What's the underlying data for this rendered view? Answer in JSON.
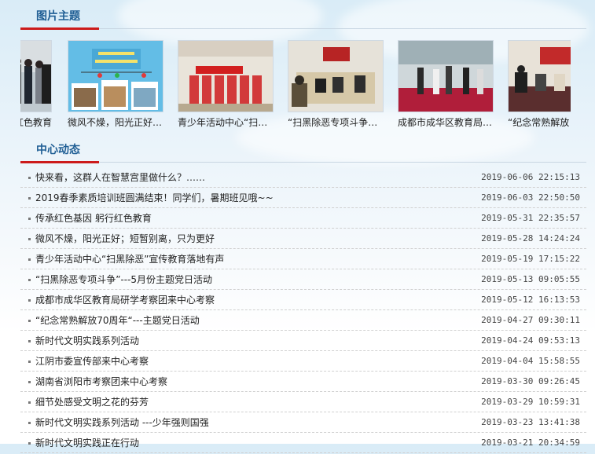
{
  "gallery": {
    "title": "图片主题",
    "items": [
      {
        "caption": "躬行红色教育"
      },
      {
        "caption": "微风不燥，阳光正好…"
      },
      {
        "caption": "青少年活动中心“扫…"
      },
      {
        "caption": "“扫黑除恶专项斗争…"
      },
      {
        "caption": "成都市成华区教育局…"
      },
      {
        "caption": "“纪念常熟解放"
      }
    ]
  },
  "news": {
    "title": "中心动态",
    "items": [
      {
        "title": "快来看，这群人在智慧宫里做什么？……",
        "date": "2019-06-06 22:15:13"
      },
      {
        "title": "2019春季素质培训班圆满结束！同学们，暑期班见哦~~",
        "date": "2019-06-03 22:50:50"
      },
      {
        "title": "传承红色基因 躬行红色教育",
        "date": "2019-05-31 22:35:57"
      },
      {
        "title": "微风不燥，阳光正好；短暂别离，只为更好",
        "date": "2019-05-28 14:24:24"
      },
      {
        "title": "青少年活动中心“扫黑除恶”宣传教育落地有声",
        "date": "2019-05-19 17:15:22"
      },
      {
        "title": "“扫黑除恶专项斗争”---5月份主题党日活动",
        "date": "2019-05-13 09:05:55"
      },
      {
        "title": "成都市成华区教育局研学考察团来中心考察",
        "date": "2019-05-12 16:13:53"
      },
      {
        "title": "“纪念常熟解放70周年“---主题党日活动",
        "date": "2019-04-27 09:30:11"
      },
      {
        "title": "新时代文明实践系列活动",
        "date": "2019-04-24 09:53:13"
      },
      {
        "title": "江阴市委宣传部来中心考察",
        "date": "2019-04-04 15:58:55"
      },
      {
        "title": "湖南省浏阳市考察团来中心考察",
        "date": "2019-03-30 09:26:45"
      },
      {
        "title": "细节处感受文明之花的芬芳",
        "date": "2019-03-29 10:59:31"
      },
      {
        "title": "新时代文明实践系列活动 ---少年强则国强",
        "date": "2019-03-23 13:41:38"
      },
      {
        "title": "新时代文明实践正在行动",
        "date": "2019-03-21 20:34:59"
      }
    ]
  }
}
